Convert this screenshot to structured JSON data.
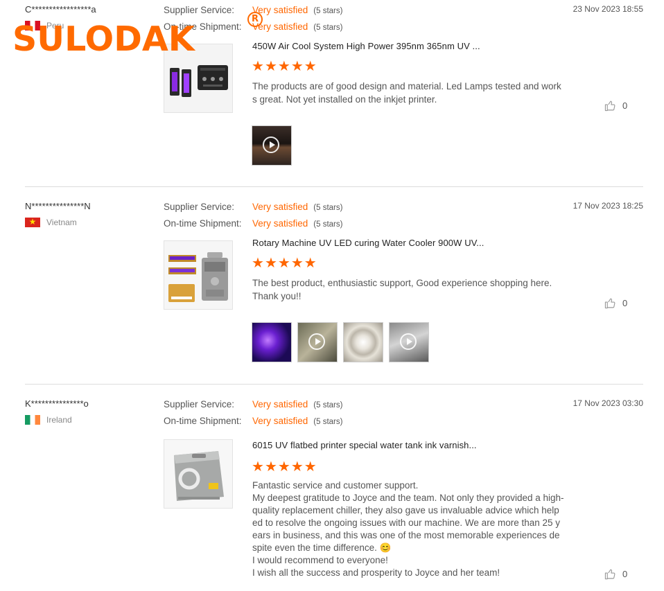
{
  "reviews": [
    {
      "buyer": "C*****************a",
      "country": "Peru",
      "supplier_label": "Supplier Service:",
      "supplier_value": "Very satisfied",
      "supplier_stars": "(5 stars)",
      "shipment_label": "On-time Shipment:",
      "shipment_value": "Very satisfied",
      "shipment_stars": "(5 stars)",
      "date": "23 Nov 2023 18:55",
      "product_title": "450W Air Cool System High Power 395nm 365nm UV ...",
      "rating": 5,
      "comment": [
        "The products are of good design and material. Led Lamps tested and works great. Not yet installed on the inkjet printer."
      ],
      "likes": "0"
    },
    {
      "buyer": "N***************N",
      "country": "Vietnam",
      "supplier_label": "Supplier Service:",
      "supplier_value": "Very satisfied",
      "supplier_stars": "(5 stars)",
      "shipment_label": "On-time Shipment:",
      "shipment_value": "Very satisfied",
      "shipment_stars": "(5 stars)",
      "date": "17 Nov 2023 18:25",
      "product_title": "Rotary Machine UV LED curing Water Cooler 900W UV...",
      "rating": 5,
      "comment": [
        "The best product, enthusiastic support, Good experience shopping here.",
        "Thank you!!"
      ],
      "likes": "0"
    },
    {
      "buyer": "K***************o",
      "country": "Ireland",
      "supplier_label": "Supplier Service:",
      "supplier_value": "Very satisfied",
      "supplier_stars": "(5 stars)",
      "shipment_label": "On-time Shipment:",
      "shipment_value": "Very satisfied",
      "shipment_stars": "(5 stars)",
      "date": "17 Nov 2023 03:30",
      "product_title": "6015 UV flatbed printer special water tank ink varnish...",
      "rating": 5,
      "comment": [
        "Fantastic service and customer support.",
        "My deepest gratitude to Joyce and the team. Not only they provided a high-quality replacement chiller, they also gave us invaluable advice which helped to resolve the ongoing issues with our machine. We are more than 25 years in business, and this was one of the most memorable experiences despite even the time difference. 😊",
        "I would recommend to everyone!",
        "I wish all the success and prosperity to Joyce and her team!"
      ],
      "likes": "0"
    }
  ],
  "watermark": {
    "text": "SULODAK",
    "registered": "R"
  }
}
